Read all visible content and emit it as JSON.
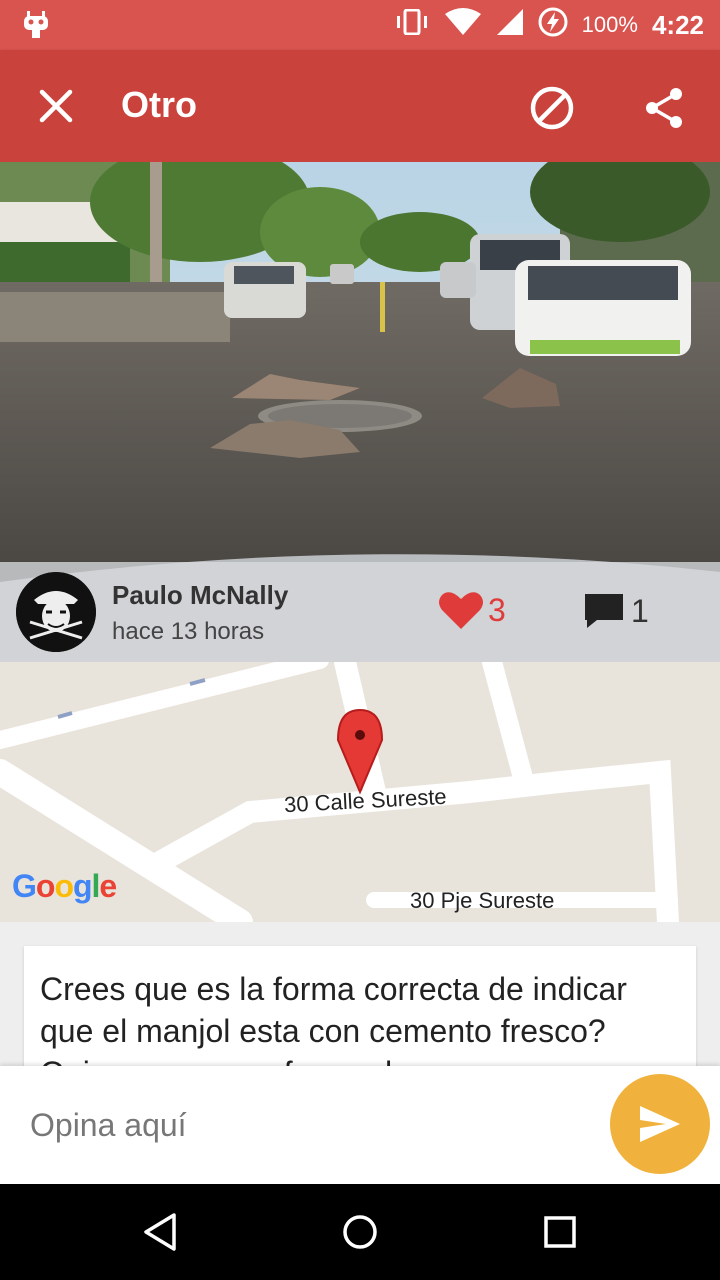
{
  "status_bar": {
    "battery_percent": "100%",
    "time": "4:22",
    "icons": [
      "app-notification-icon",
      "vibrate-icon",
      "wifi-icon",
      "signal-icon",
      "battery-charging-icon"
    ]
  },
  "toolbar": {
    "title": "Otro",
    "close_icon": "close-icon",
    "block_icon": "block-icon",
    "share_icon": "share-icon"
  },
  "post": {
    "author": "Paulo McNally",
    "time_ago": "hace 13 horas",
    "likes": "3",
    "comments": "1",
    "description": "Crees que es la forma correcta de indicar que el manjol esta con cemento fresco? Opino que no es forma de"
  },
  "map": {
    "street_main": "30 Calle Sureste",
    "street_secondary": "30 Pje Sureste",
    "provider": "Google"
  },
  "comment_input": {
    "placeholder": "Opina aquí"
  },
  "colors": {
    "status_bar": "#d9534f",
    "toolbar": "#c9423c",
    "accent": "#f0b23c",
    "like": "#e03b3b"
  }
}
